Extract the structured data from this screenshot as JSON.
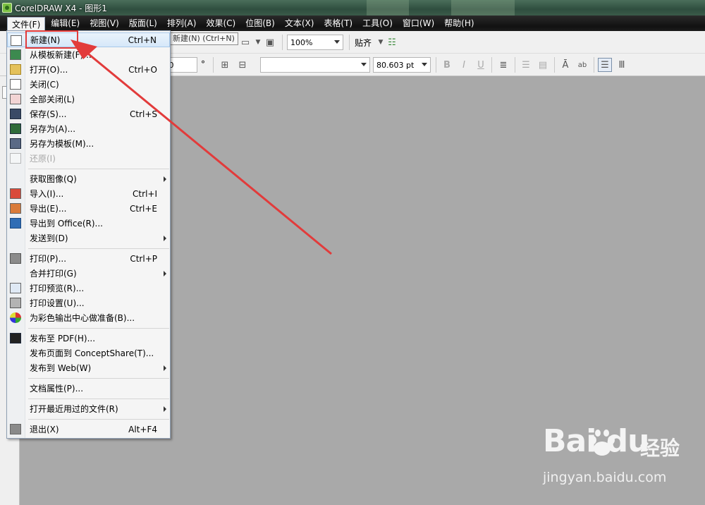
{
  "window": {
    "title": "CorelDRAW X4 - 图形1"
  },
  "menubar": [
    {
      "id": "file",
      "label": "文件(F)"
    },
    {
      "id": "edit",
      "label": "编辑(E)"
    },
    {
      "id": "view",
      "label": "视图(V)"
    },
    {
      "id": "layout",
      "label": "版面(L)"
    },
    {
      "id": "arrange",
      "label": "排列(A)"
    },
    {
      "id": "effects",
      "label": "效果(C)"
    },
    {
      "id": "bitmaps",
      "label": "位图(B)"
    },
    {
      "id": "text",
      "label": "文本(X)"
    },
    {
      "id": "table",
      "label": "表格(T)"
    },
    {
      "id": "tools",
      "label": "工具(O)"
    },
    {
      "id": "window",
      "label": "窗口(W)"
    },
    {
      "id": "help",
      "label": "帮助(H)"
    }
  ],
  "toolbar": {
    "zoom": "100%",
    "snap_label": "贴齐",
    "angle_value": ".0",
    "degree_symbol": "°",
    "font_name": "",
    "font_size": "80.603 pt"
  },
  "tooltip": "新建(N) (Ctrl+N)",
  "file_menu": {
    "items": [
      {
        "label": "新建(N)",
        "shortcut": "Ctrl+N",
        "icon": "new-document-icon",
        "highlight": true
      },
      {
        "label": "从模板新建(F)...",
        "shortcut": "",
        "icon": "new-from-template-icon"
      },
      {
        "label": "打开(O)...",
        "shortcut": "Ctrl+O",
        "icon": "open-folder-icon"
      },
      {
        "label": "关闭(C)",
        "shortcut": "",
        "icon": "close-document-icon"
      },
      {
        "label": "全部关闭(L)",
        "shortcut": "",
        "icon": "close-all-icon"
      },
      {
        "label": "保存(S)...",
        "shortcut": "Ctrl+S",
        "icon": "save-disk-icon"
      },
      {
        "label": "另存为(A)...",
        "shortcut": "",
        "icon": "save-as-icon"
      },
      {
        "label": "另存为模板(M)...",
        "shortcut": "",
        "icon": "save-as-template-icon"
      },
      {
        "label": "还原(I)",
        "shortcut": "",
        "icon": "revert-icon",
        "disabled": true
      },
      {
        "label": "获取图像(Q)",
        "shortcut": "",
        "icon": "",
        "submenu": true
      },
      {
        "label": "导入(I)...",
        "shortcut": "Ctrl+I",
        "icon": "import-icon"
      },
      {
        "label": "导出(E)...",
        "shortcut": "Ctrl+E",
        "icon": "export-icon"
      },
      {
        "label": "导出到 Office(R)...",
        "shortcut": "",
        "icon": "export-office-icon"
      },
      {
        "label": "发送到(D)",
        "shortcut": "",
        "icon": "",
        "submenu": true
      },
      {
        "label": "打印(P)...",
        "shortcut": "Ctrl+P",
        "icon": "printer-icon"
      },
      {
        "label": "合并打印(G)",
        "shortcut": "",
        "icon": "",
        "submenu": true
      },
      {
        "label": "打印预览(R)...",
        "shortcut": "",
        "icon": "print-preview-icon"
      },
      {
        "label": "打印设置(U)...",
        "shortcut": "",
        "icon": "print-setup-icon"
      },
      {
        "label": "为彩色输出中心做准备(B)...",
        "shortcut": "",
        "icon": "color-output-icon"
      },
      {
        "label": "发布至 PDF(H)...",
        "shortcut": "",
        "icon": "pdf-icon"
      },
      {
        "label": "发布页面到 ConceptShare(T)...",
        "shortcut": "",
        "icon": ""
      },
      {
        "label": "发布到 Web(W)",
        "shortcut": "",
        "icon": "",
        "submenu": true
      },
      {
        "label": "文档属性(P)...",
        "shortcut": "",
        "icon": ""
      },
      {
        "label": "打开最近用过的文件(R)",
        "shortcut": "",
        "icon": "",
        "submenu": true
      },
      {
        "label": "退出(X)",
        "shortcut": "Alt+F4",
        "icon": "exit-icon"
      }
    ]
  },
  "watermark": {
    "logo": "Bai du",
    "cn": "经验",
    "url": "jingyan.baidu.com"
  },
  "colors": {
    "annotation_red": "#e23b3b",
    "menu_highlight": "#d6e8f9",
    "canvas": "#a9a9a9"
  }
}
